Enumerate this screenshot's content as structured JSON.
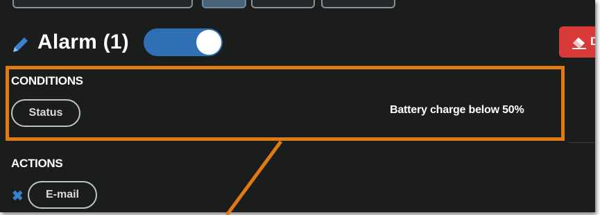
{
  "alarm": {
    "title": "Alarm (1)",
    "enabled": true,
    "delete_label": "D"
  },
  "conditions": {
    "heading": "CONDITIONS",
    "pill_label": "Status",
    "description": "Battery charge below 50%"
  },
  "actions": {
    "heading": "ACTIONS",
    "pill_label": "E-mail"
  },
  "colors": {
    "panel_bg": "#1b1d1d",
    "toggle_on": "#2f6fb3",
    "delete_red": "#d83a3a",
    "highlight_orange": "#e07a12",
    "icon_blue": "#3a82d0"
  },
  "icons": {
    "edit": "pencil-icon",
    "toggle": "toggle-switch",
    "delete": "eraser-icon",
    "remove": "close-icon"
  }
}
